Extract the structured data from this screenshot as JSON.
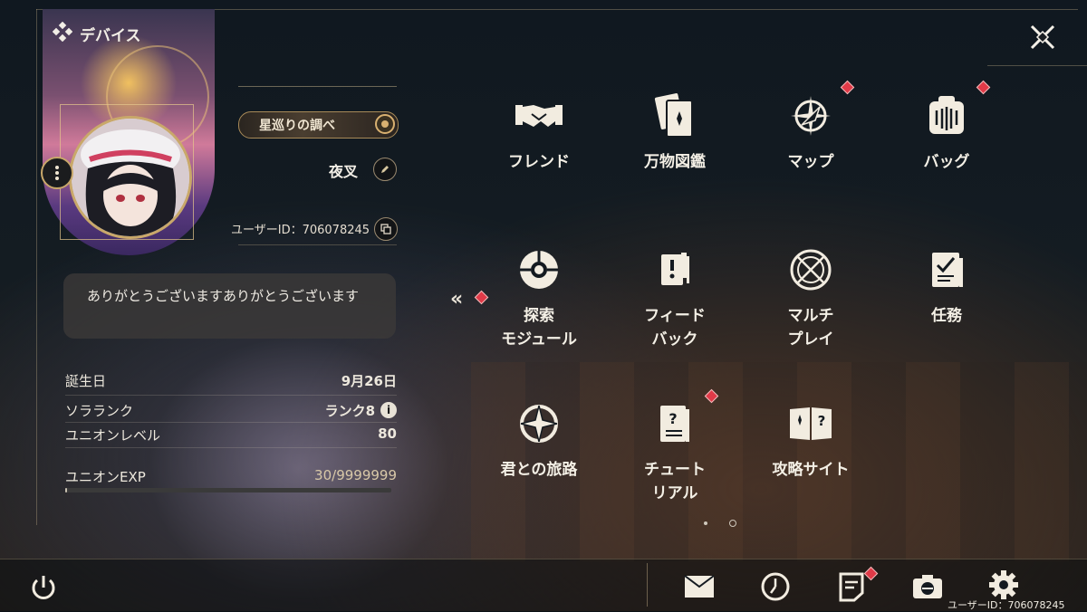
{
  "title": "デバイス",
  "profile": {
    "badge": "星巡りの調べ",
    "name": "夜叉",
    "user_id": "ユーザーID：706078245",
    "message": "ありがとうございますありがとうございます"
  },
  "stats": [
    {
      "label": "誕生日",
      "value": "9月26日"
    },
    {
      "label": "ソラランク",
      "value": "ランク8"
    },
    {
      "label": "ユニオンレベル",
      "value": "80"
    },
    {
      "label": "ユニオンEXP",
      "value": "30/9999999"
    }
  ],
  "exp_progress": 3e-06,
  "menu": [
    {
      "label": "フレンド",
      "icon": "handshake-icon"
    },
    {
      "label": "万物図鑑",
      "icon": "cards-icon"
    },
    {
      "label": "マップ",
      "icon": "compass-icon",
      "notify": true
    },
    {
      "label": "バッグ",
      "icon": "bag-icon",
      "notify": true
    },
    {
      "label": "探索\nモジュール",
      "icon": "module-icon"
    },
    {
      "label": "フィード\nバック",
      "icon": "feedback-icon"
    },
    {
      "label": "マルチ\nプレイ",
      "icon": "multiplayer-icon"
    },
    {
      "label": "任務",
      "icon": "mission-icon"
    },
    {
      "label": "君との旅路",
      "icon": "journey-icon"
    },
    {
      "label": "チュート\nリアル",
      "icon": "tutorial-icon",
      "notify": true
    },
    {
      "label": "攻略サイト",
      "icon": "guide-icon"
    }
  ],
  "pager": {
    "count": 2,
    "active": 1
  },
  "footer": {
    "user_id": "ユーザーID：706078245",
    "icons": [
      "mail-icon",
      "clock-icon",
      "notes-icon",
      "camera-icon",
      "gear-icon"
    ]
  },
  "colors": {
    "accent": "#c9a86a",
    "notify": "#e03a48"
  }
}
